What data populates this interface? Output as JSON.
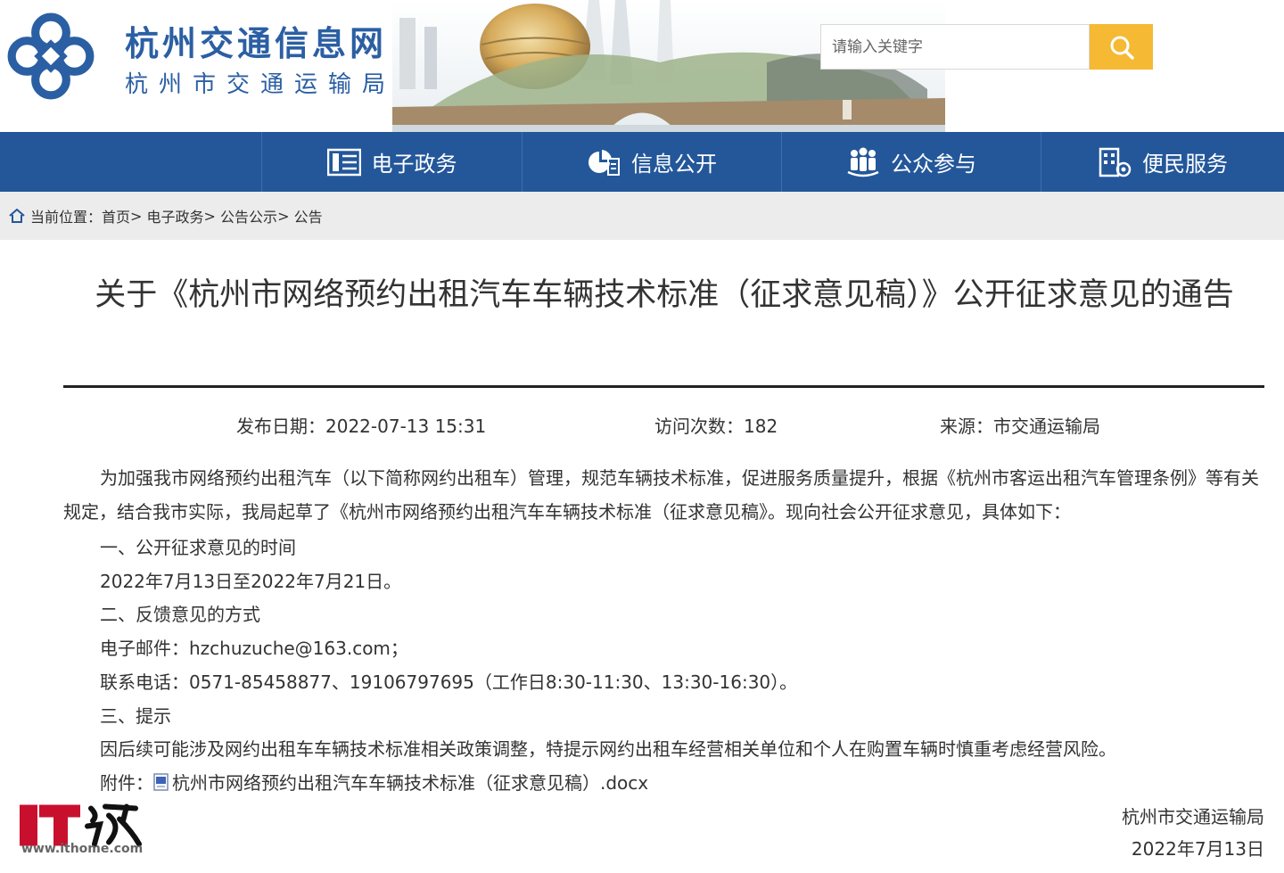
{
  "header": {
    "site_title": "杭州交通信息网",
    "site_subtitle": "杭州市交通运输局",
    "search_placeholder": "请输入关键字",
    "accent_color": "#23579a",
    "search_button_color": "#f5b933"
  },
  "nav": {
    "items": [
      {
        "label": "电子政务",
        "icon": "list-icon"
      },
      {
        "label": "信息公开",
        "icon": "info-pie-icon"
      },
      {
        "label": "公众参与",
        "icon": "people-icon"
      },
      {
        "label": "便民服务",
        "icon": "service-building-icon"
      }
    ]
  },
  "breadcrumb": {
    "prefix": "当前位置：",
    "items": [
      "首页",
      "电子政务",
      "公告公示",
      "公告"
    ],
    "separator": ">"
  },
  "article": {
    "title": "关于《杭州市网络预约出租汽车车辆技术标准（征求意见稿）》公开征求意见的通告",
    "publish_date": "发布日期：2022-07-13 15:31",
    "visits": "访问次数：182",
    "source": "来源：市交通运输局",
    "intro": "为加强我市网络预约出租汽车（以下简称网约出租车）管理，规范车辆技术标准，促进服务质量提升，根据《杭州市客运出租汽车管理条例》等有关规定，结合我市实际，我局起草了《杭州市网络预约出租汽车车辆技术标准（征求意见稿》。现向社会公开征求意见，具体如下：",
    "section1_title": "一、公开征求意见的时间",
    "section1_body": "2022年7月13日至2022年7月21日。",
    "section2_title": "二、反馈意见的方式",
    "email": "电子邮件：hzchuzuche@163.com；",
    "phone": "联系电话：0571-85458877、19106797695（工作日8:30-11:30、13:30-16:30）。",
    "section3_title": "三、提示",
    "section3_body": "因后续可能涉及网约出租车车辆技术标准相关政策调整，特提示网约出租车经营相关单位和个人在购置车辆时慎重考虑经营风险。",
    "attachment_label": "附件：",
    "attachment_name": "杭州市网络预约出租汽车车辆技术标准（征求意见稿）.docx",
    "signature_org": "杭州市交通运输局",
    "signature_date": "2022年7月13日"
  },
  "watermark": {
    "brand": "IT之家",
    "url": "www.ithome.com"
  }
}
